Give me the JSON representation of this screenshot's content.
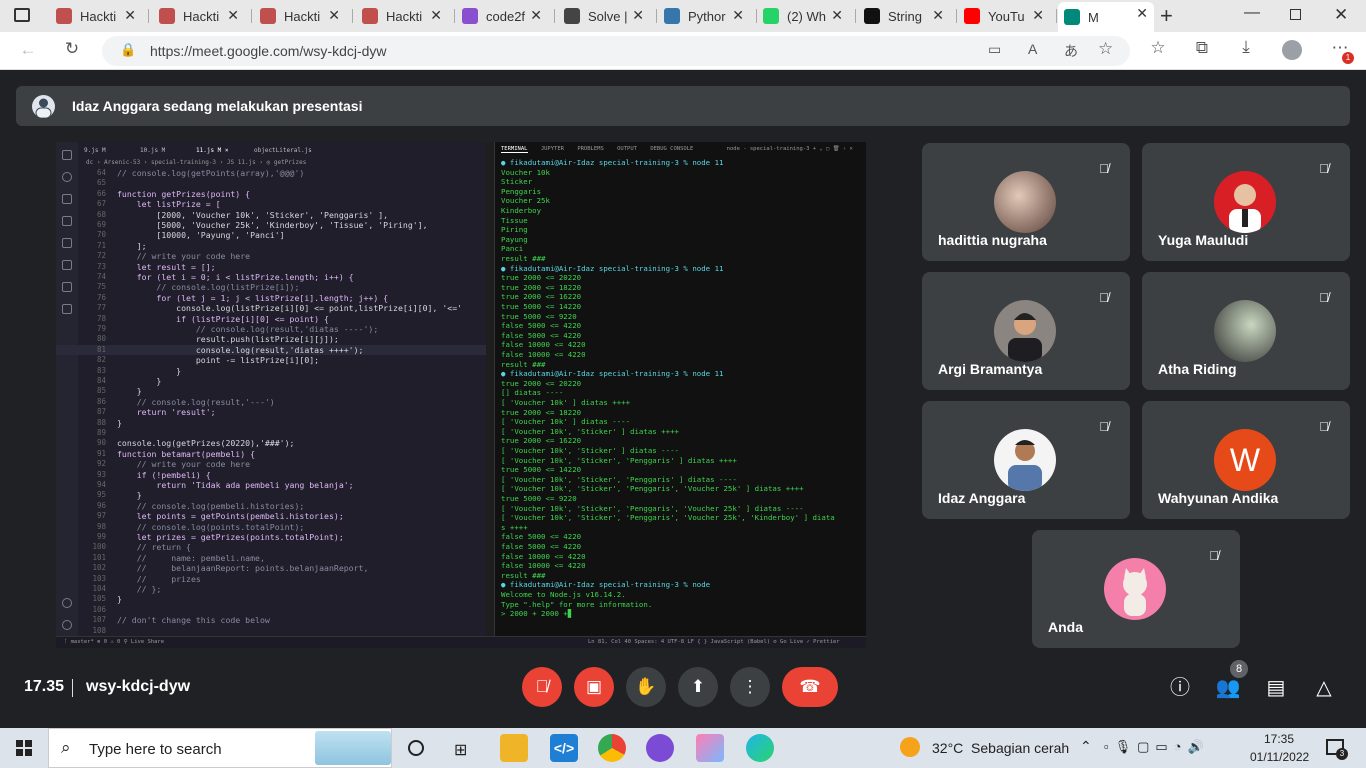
{
  "browser": {
    "tabs": [
      {
        "title": "Hackti",
        "icon": "hacktiv8-icon",
        "color": "#c0504d"
      },
      {
        "title": "Hackti",
        "icon": "hacktiv8-icon",
        "color": "#c0504d"
      },
      {
        "title": "Hackti",
        "icon": "hacktiv8-icon",
        "color": "#c0504d"
      },
      {
        "title": "Hackti",
        "icon": "hacktiv8-icon",
        "color": "#c0504d"
      },
      {
        "title": "code2f",
        "icon": "code2flow-icon",
        "color": "#8a4fcf"
      },
      {
        "title": "Solve |",
        "icon": "codewars-icon",
        "color": "#444444"
      },
      {
        "title": "Pythor",
        "icon": "python-icon",
        "color": "#3776ab"
      },
      {
        "title": "(2) Wh",
        "icon": "whatsapp-icon",
        "color": "#25d366"
      },
      {
        "title": "String",
        "icon": "medium-icon",
        "color": "#111111"
      },
      {
        "title": "YouTu",
        "icon": "youtube-icon",
        "color": "#ff0000"
      },
      {
        "title": "M",
        "icon": "google-meet-icon",
        "color": "#00897b"
      }
    ],
    "url": "https://meet.google.com/wsy-kdcj-dyw",
    "notification_count": "1"
  },
  "meet": {
    "presenter_banner": "Idaz Anggara sedang melakukan presentasi",
    "time": "17.35",
    "meeting_code": "wsy-kdcj-dyw",
    "people_count": "8",
    "participants": [
      {
        "name": "hadittia nugraha"
      },
      {
        "name": "Yuga Mauludi"
      },
      {
        "name": "Argi Bramantya"
      },
      {
        "name": "Atha Riding"
      },
      {
        "name": "Idaz Anggara"
      },
      {
        "name": "Wahyunan Andika",
        "initial": "W"
      },
      {
        "name": "Anda"
      }
    ]
  },
  "shared_screen": {
    "editor_tabs": [
      "9.js  M",
      "10.js  M",
      "11.js  M  ×",
      "objectLiteral.js"
    ],
    "breadcrumb": "dc › Arsenic-53 › special-training-3 › JS 11.js › ◎ getPrizes",
    "code_lines": [
      {
        "n": "64",
        "text": "// console.log(getPoints(array),'@@@')"
      },
      {
        "n": "65",
        "text": ""
      },
      {
        "n": "66",
        "text": "function getPrizes(point) {"
      },
      {
        "n": "67",
        "text": "    let listPrize = ["
      },
      {
        "n": "68",
        "text": "        [2000, 'Voucher 10k', 'Sticker', 'Penggaris' ],"
      },
      {
        "n": "69",
        "text": "        [5000, 'Voucher 25k', 'Kinderboy', 'Tissue', 'Piring'],"
      },
      {
        "n": "70",
        "text": "        [10000, 'Payung', 'Panci']"
      },
      {
        "n": "71",
        "text": "    ];"
      },
      {
        "n": "72",
        "text": "    // write your code here"
      },
      {
        "n": "73",
        "text": "    let result = [];"
      },
      {
        "n": "74",
        "text": "    for (let i = 0; i < listPrize.length; i++) {"
      },
      {
        "n": "75",
        "text": "        // console.log(listPrize[i]);"
      },
      {
        "n": "76",
        "text": "        for (let j = 1; j < listPrize[i].length; j++) {"
      },
      {
        "n": "77",
        "text": "            console.log(listPrize[i][0] <= point,listPrize[i][0], '<='"
      },
      {
        "n": "78",
        "text": "            if (listPrize[i][0] <= point) {"
      },
      {
        "n": "79",
        "text": "                // console.log(result,'diatas ----');"
      },
      {
        "n": "80",
        "text": "                result.push(listPrize[i][j]);"
      },
      {
        "n": "81",
        "text": "                console.log(result,'diatas ++++');"
      },
      {
        "n": "82",
        "text": "                point -= listPrize[i][0];"
      },
      {
        "n": "83",
        "text": "            }"
      },
      {
        "n": "84",
        "text": "        }"
      },
      {
        "n": "85",
        "text": "    }"
      },
      {
        "n": "86",
        "text": "    // console.log(result,'---')"
      },
      {
        "n": "87",
        "text": "    return 'result';"
      },
      {
        "n": "88",
        "text": "}"
      },
      {
        "n": "89",
        "text": ""
      },
      {
        "n": "90",
        "text": "console.log(getPrizes(20220),'###');"
      },
      {
        "n": "91",
        "text": "function betamart(pembeli) {"
      },
      {
        "n": "92",
        "text": "    // write your code here"
      },
      {
        "n": "93",
        "text": "    if (!pembeli) {"
      },
      {
        "n": "94",
        "text": "        return 'Tidak ada pembeli yang belanja';"
      },
      {
        "n": "95",
        "text": "    }"
      },
      {
        "n": "96",
        "text": "    // console.log(pembeli.histories);"
      },
      {
        "n": "97",
        "text": "    let points = getPoints(pembeli.histories);"
      },
      {
        "n": "98",
        "text": "    // console.log(points.totalPoint);"
      },
      {
        "n": "99",
        "text": "    let prizes = getPrizes(points.totalPoint);"
      },
      {
        "n": "100",
        "text": "    // return {"
      },
      {
        "n": "101",
        "text": "    //     name: pembeli.name,"
      },
      {
        "n": "102",
        "text": "    //     belanjaanReport: points.belanjaanReport,"
      },
      {
        "n": "103",
        "text": "    //     prizes"
      },
      {
        "n": "104",
        "text": "    // };"
      },
      {
        "n": "105",
        "text": "}"
      },
      {
        "n": "106",
        "text": ""
      },
      {
        "n": "107",
        "text": "// don't change this code below"
      },
      {
        "n": "108",
        "text": ""
      }
    ],
    "terminal_tabs": [
      "TERMINAL",
      "JUPYTER",
      "PROBLEMS",
      "OUTPUT",
      "DEBUG CONSOLE",
      "node - special-training-3  + ⌄ ▢ 🗑 ‹ ×"
    ],
    "terminal_lines": [
      {
        "text": "● fikadutami@Air-Idaz special-training-3 % node 11",
        "k": "c"
      },
      {
        "text": "Voucher 10k",
        "k": "g"
      },
      {
        "text": "Sticker",
        "k": "g"
      },
      {
        "text": "Penggaris",
        "k": "g"
      },
      {
        "text": "Voucher 25k",
        "k": "g"
      },
      {
        "text": "Kinderboy",
        "k": "g"
      },
      {
        "text": "Tissue",
        "k": "g"
      },
      {
        "text": "Piring",
        "k": "g"
      },
      {
        "text": "Payung",
        "k": "g"
      },
      {
        "text": "Panci",
        "k": "g"
      },
      {
        "text": "result ###",
        "k": "g"
      },
      {
        "text": "● fikadutami@Air-Idaz special-training-3 % node 11",
        "k": "c"
      },
      {
        "text": "true 2000 <= 20220",
        "k": "g"
      },
      {
        "text": "true 2000 <= 18220",
        "k": "g"
      },
      {
        "text": "true 2000 <= 16220",
        "k": "g"
      },
      {
        "text": "true 5000 <= 14220",
        "k": "g"
      },
      {
        "text": "true 5000 <= 9220",
        "k": "g"
      },
      {
        "text": "false 5000 <= 4220",
        "k": "g"
      },
      {
        "text": "false 5000 <= 4220",
        "k": "g"
      },
      {
        "text": "false 10000 <= 4220",
        "k": "g"
      },
      {
        "text": "false 10000 <= 4220",
        "k": "g"
      },
      {
        "text": "result ###",
        "k": "g"
      },
      {
        "text": "● fikadutami@Air-Idaz special-training-3 % node 11",
        "k": "c"
      },
      {
        "text": "true 2000 <= 20220",
        "k": "g"
      },
      {
        "text": "[] diatas ----",
        "k": "g"
      },
      {
        "text": "[ 'Voucher 10k' ] diatas ++++",
        "k": "g"
      },
      {
        "text": "true 2000 <= 18220",
        "k": "g"
      },
      {
        "text": "[ 'Voucher 10k' ] diatas ----",
        "k": "g"
      },
      {
        "text": "[ 'Voucher 10k', 'Sticker' ] diatas ++++",
        "k": "g"
      },
      {
        "text": "true 2000 <= 16220",
        "k": "g"
      },
      {
        "text": "[ 'Voucher 10k', 'Sticker' ] diatas ----",
        "k": "g"
      },
      {
        "text": "[ 'Voucher 10k', 'Sticker', 'Penggaris' ] diatas ++++",
        "k": "g"
      },
      {
        "text": "true 5000 <= 14220",
        "k": "g"
      },
      {
        "text": "[ 'Voucher 10k', 'Sticker', 'Penggaris' ] diatas ----",
        "k": "g"
      },
      {
        "text": "[ 'Voucher 10k', 'Sticker', 'Penggaris', 'Voucher 25k' ] diatas ++++",
        "k": "g"
      },
      {
        "text": "true 5000 <= 9220",
        "k": "g"
      },
      {
        "text": "[ 'Voucher 10k', 'Sticker', 'Penggaris', 'Voucher 25k' ] diatas ----",
        "k": "g"
      },
      {
        "text": "[ 'Voucher 10k', 'Sticker', 'Penggaris', 'Voucher 25k', 'Kinderboy' ] diata",
        "k": "g"
      },
      {
        "text": "s ++++",
        "k": "g"
      },
      {
        "text": "false 5000 <= 4220",
        "k": "g"
      },
      {
        "text": "false 5000 <= 4220",
        "k": "g"
      },
      {
        "text": "false 10000 <= 4220",
        "k": "g"
      },
      {
        "text": "false 10000 <= 4220",
        "k": "g"
      },
      {
        "text": "result ###",
        "k": "g"
      },
      {
        "text": "● fikadutami@Air-Idaz special-training-3 % node",
        "k": "c"
      },
      {
        "text": "Welcome to Node.js v16.14.2.",
        "k": "g"
      },
      {
        "text": "Type \".help\" for more information.",
        "k": "g"
      },
      {
        "text": "> 2000 + 2000 +▊",
        "k": "g"
      }
    ],
    "status_left": "ᚴ master*  ⊗ 0 ⚠ 0   ⚲ Live Share",
    "status_right": "Ln 81, Col 40   Spaces: 4   UTF-8   LF   { } JavaScript (Babel)   ⊘ Go Live   ✓ Prettier"
  },
  "taskbar": {
    "search_placeholder": "Type here to search",
    "weather": "32°C  Sebagian cerah",
    "time": "17:35",
    "date": "01/11/2022",
    "notification_count": "3"
  }
}
